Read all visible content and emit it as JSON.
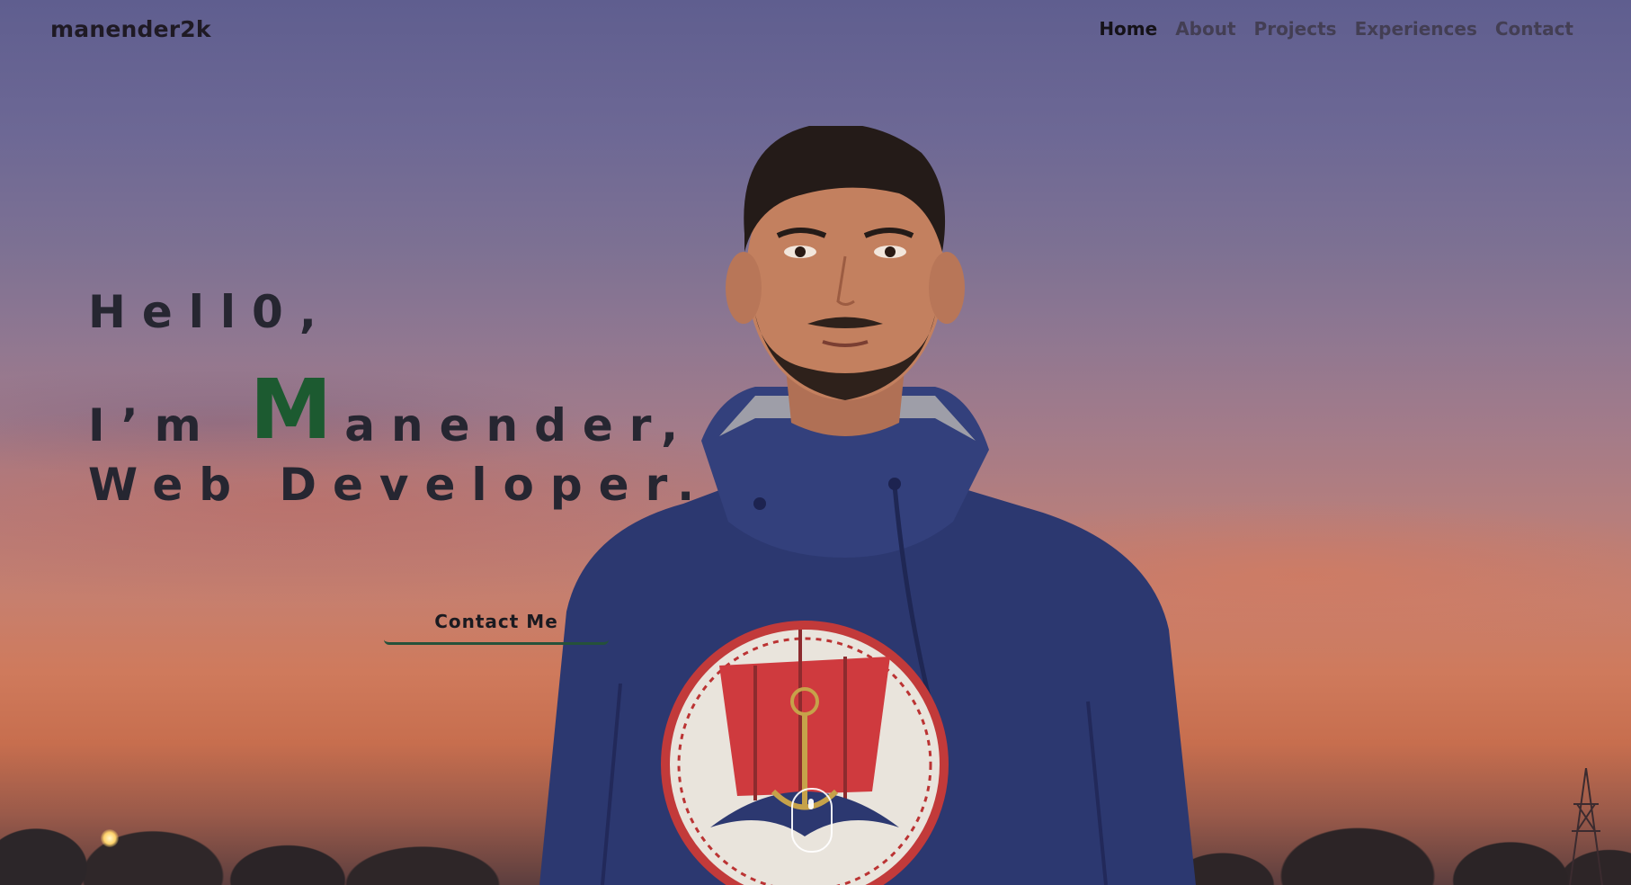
{
  "brand": "manender2k",
  "nav": {
    "items": [
      {
        "label": "Home",
        "active": true
      },
      {
        "label": "About",
        "active": false
      },
      {
        "label": "Projects",
        "active": false
      },
      {
        "label": "Experiences",
        "active": false
      },
      {
        "label": "Contact",
        "active": false
      }
    ]
  },
  "hero": {
    "line1": "Hell0,",
    "line2_prefix": "I’m",
    "name_initial": "M",
    "name_rest": "anender,",
    "line3": "Web Developer.",
    "cta_label": "Contact Me"
  },
  "colors": {
    "accent": "#1c5a30",
    "text": "#262631",
    "sweatshirt": "#2c3870"
  },
  "icons": {
    "scroll": "mouse-scroll-icon"
  }
}
